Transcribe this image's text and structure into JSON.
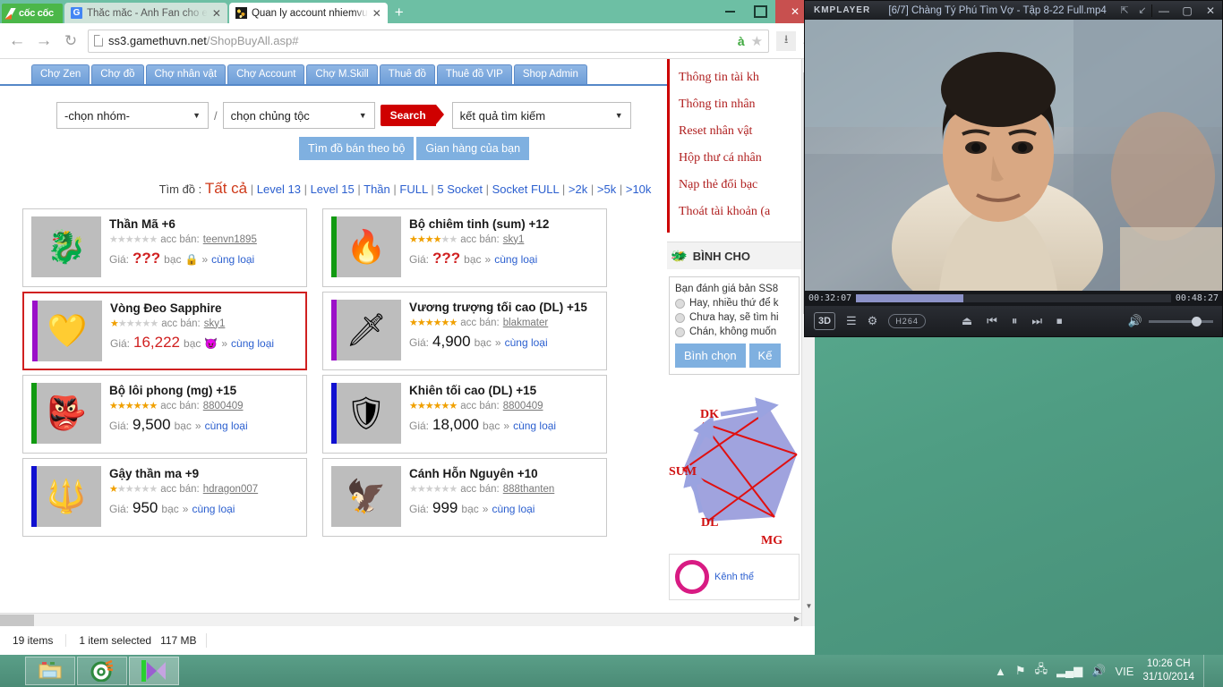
{
  "browser": {
    "brand": "cốc cốc",
    "tabs": [
      {
        "label": "Thắc mắc - Anh Fan cho e",
        "icon": "google-favicon",
        "active": false
      },
      {
        "label": "Quan ly account nhiemvu",
        "icon": "mu-favicon",
        "active": true
      }
    ],
    "newtab_label": "+",
    "url_host": "ss3.gamethuvn.net",
    "url_path": "/ShopBuyAll.asp#",
    "omnibox_icons": {
      "translate": "à",
      "bookmark": "★",
      "download_box": "⭳",
      "download_bar": "⭳"
    },
    "nav_icons": {
      "back": "←",
      "forward": "→",
      "reload": "↻"
    },
    "window_buttons": {
      "minimize": "—",
      "maximize": "▢",
      "close": "✕"
    }
  },
  "site": {
    "nav_tabs": [
      "Chợ Zen",
      "Chợ đồ",
      "Chợ nhân vật",
      "Chợ Account",
      "Chợ M.Skill",
      "Thuê đồ",
      "Thuê đồ VIP",
      "Shop Admin"
    ],
    "filters": {
      "group_select": "-chọn nhóm-",
      "separator": "/",
      "race_select": "chọn chủng tộc",
      "search_button": "Search",
      "result_select": "kết quả tìm kiếm",
      "sub_buttons": [
        "Tìm đồ bán theo bộ",
        "Gian hàng của bạn"
      ]
    },
    "find_row": {
      "label": "Tìm đồ :",
      "current": "Tất cả",
      "links": [
        "Level 13",
        "Level 15",
        "Thần",
        "FULL",
        "5 Socket",
        "Socket FULL",
        ">2k",
        ">5k",
        ">10k"
      ]
    },
    "labels": {
      "price_prefix": "Giá:",
      "currency": "bạc",
      "seller_prefix": "acc bán:",
      "same_type": "cùng loại",
      "chevron": "»"
    },
    "items": [
      {
        "name": "Thần Mã +6",
        "stars": 0,
        "seller": "teenvn1895",
        "price": "???",
        "accent": "#bdbdbd",
        "sprite": "🐉",
        "locked": true,
        "selected": false,
        "price_style": "q"
      },
      {
        "name": "Bộ chiêm tinh (sum) +12",
        "stars": 4,
        "seller": "sky1",
        "price": "???",
        "accent": "#119a11",
        "sprite": "🔥",
        "locked": false,
        "selected": false,
        "price_style": "q"
      },
      {
        "name": "Vòng Đeo Sapphire",
        "stars": 1,
        "seller": "sky1",
        "price": "16,222",
        "accent": "#9b10c8",
        "sprite": "💛",
        "locked": false,
        "selected": true,
        "price_style": "red",
        "badge": "😈"
      },
      {
        "name": "Vương trượng tối cao (DL) +15",
        "stars": 6,
        "seller": "blakmater",
        "price": "4,900",
        "accent": "#9b10c8",
        "sprite": "🗡",
        "locked": false,
        "selected": false,
        "price_style": ""
      },
      {
        "name": "Bộ lôi phong (mg) +15",
        "stars": 6,
        "seller": "8800409",
        "price": "9,500",
        "accent": "#119a11",
        "sprite": "👺",
        "locked": false,
        "selected": false,
        "price_style": ""
      },
      {
        "name": "Khiên tối cao (DL) +15",
        "stars": 6,
        "seller": "8800409",
        "price": "18,000",
        "accent": "#1010d0",
        "sprite": "🛡",
        "locked": false,
        "selected": false,
        "price_style": ""
      },
      {
        "name": "Gậy thần ma +9",
        "stars": 1,
        "seller": "hdragon007",
        "price": "950",
        "accent": "#1010d0",
        "sprite": "🔱",
        "locked": false,
        "selected": false,
        "price_style": ""
      },
      {
        "name": "Cánh Hỗn Nguyên +10",
        "stars": 0,
        "seller": "888thanten",
        "price": "999",
        "accent": "#bdbdbd",
        "sprite": "🦅",
        "locked": false,
        "selected": false,
        "price_style": ""
      }
    ],
    "sidebar": {
      "menu": [
        "Thông tin tài kh",
        "Thông tin nhân",
        "Reset nhân vật",
        "Hộp thư cá nhân",
        "Nạp thẻ đổi bạc",
        "Thoát tài khoản (a"
      ],
      "poll_heading": "BÌNH CHO",
      "poll_question": "Bạn đánh giá bản SS8",
      "poll_options": [
        "Hay, nhiều thứ để k",
        "Chưa hay, sẽ tìm hi",
        "Chán, không muốn"
      ],
      "poll_buttons": [
        "Bình chọn",
        "Kế"
      ],
      "diagram_labels": [
        "DK",
        "SUM",
        "DL",
        "MG"
      ],
      "bottom_text": "Kênh thể"
    }
  },
  "explorer_status": {
    "items_count": "19 items",
    "selection": "1 item selected",
    "size": "117 MB"
  },
  "kmplayer": {
    "logo": "KMPLAYER",
    "title": "[6/7] Chàng Tý Phú Tìm Vợ - Tập 8-22 Full.mp4",
    "title_buttons": [
      "⇱",
      "↙"
    ],
    "window_buttons": {
      "minimize": "—",
      "maximize": "▢",
      "close": "✕"
    },
    "elapsed": "00:32:07",
    "total": "00:48:27",
    "progress_percent": 34,
    "controls": {
      "threed": "3D",
      "playlist": "☰",
      "settings": "⚙",
      "codec": "H264",
      "eject": "⏏",
      "previous": "⏮",
      "pause": "⏸",
      "next": "⏭",
      "stop": "⏹",
      "volume": "🔊"
    }
  },
  "taskbar": {
    "items": [
      "file-explorer",
      "cd-burner",
      "media-player"
    ],
    "tray": {
      "arrow": "▲",
      "flag": "⚑",
      "network": "🖧",
      "signal": "▂▄▆",
      "volume": "🔊",
      "language": "VIE"
    },
    "clock_time": "10:26 CH",
    "clock_date": "31/10/2014"
  }
}
